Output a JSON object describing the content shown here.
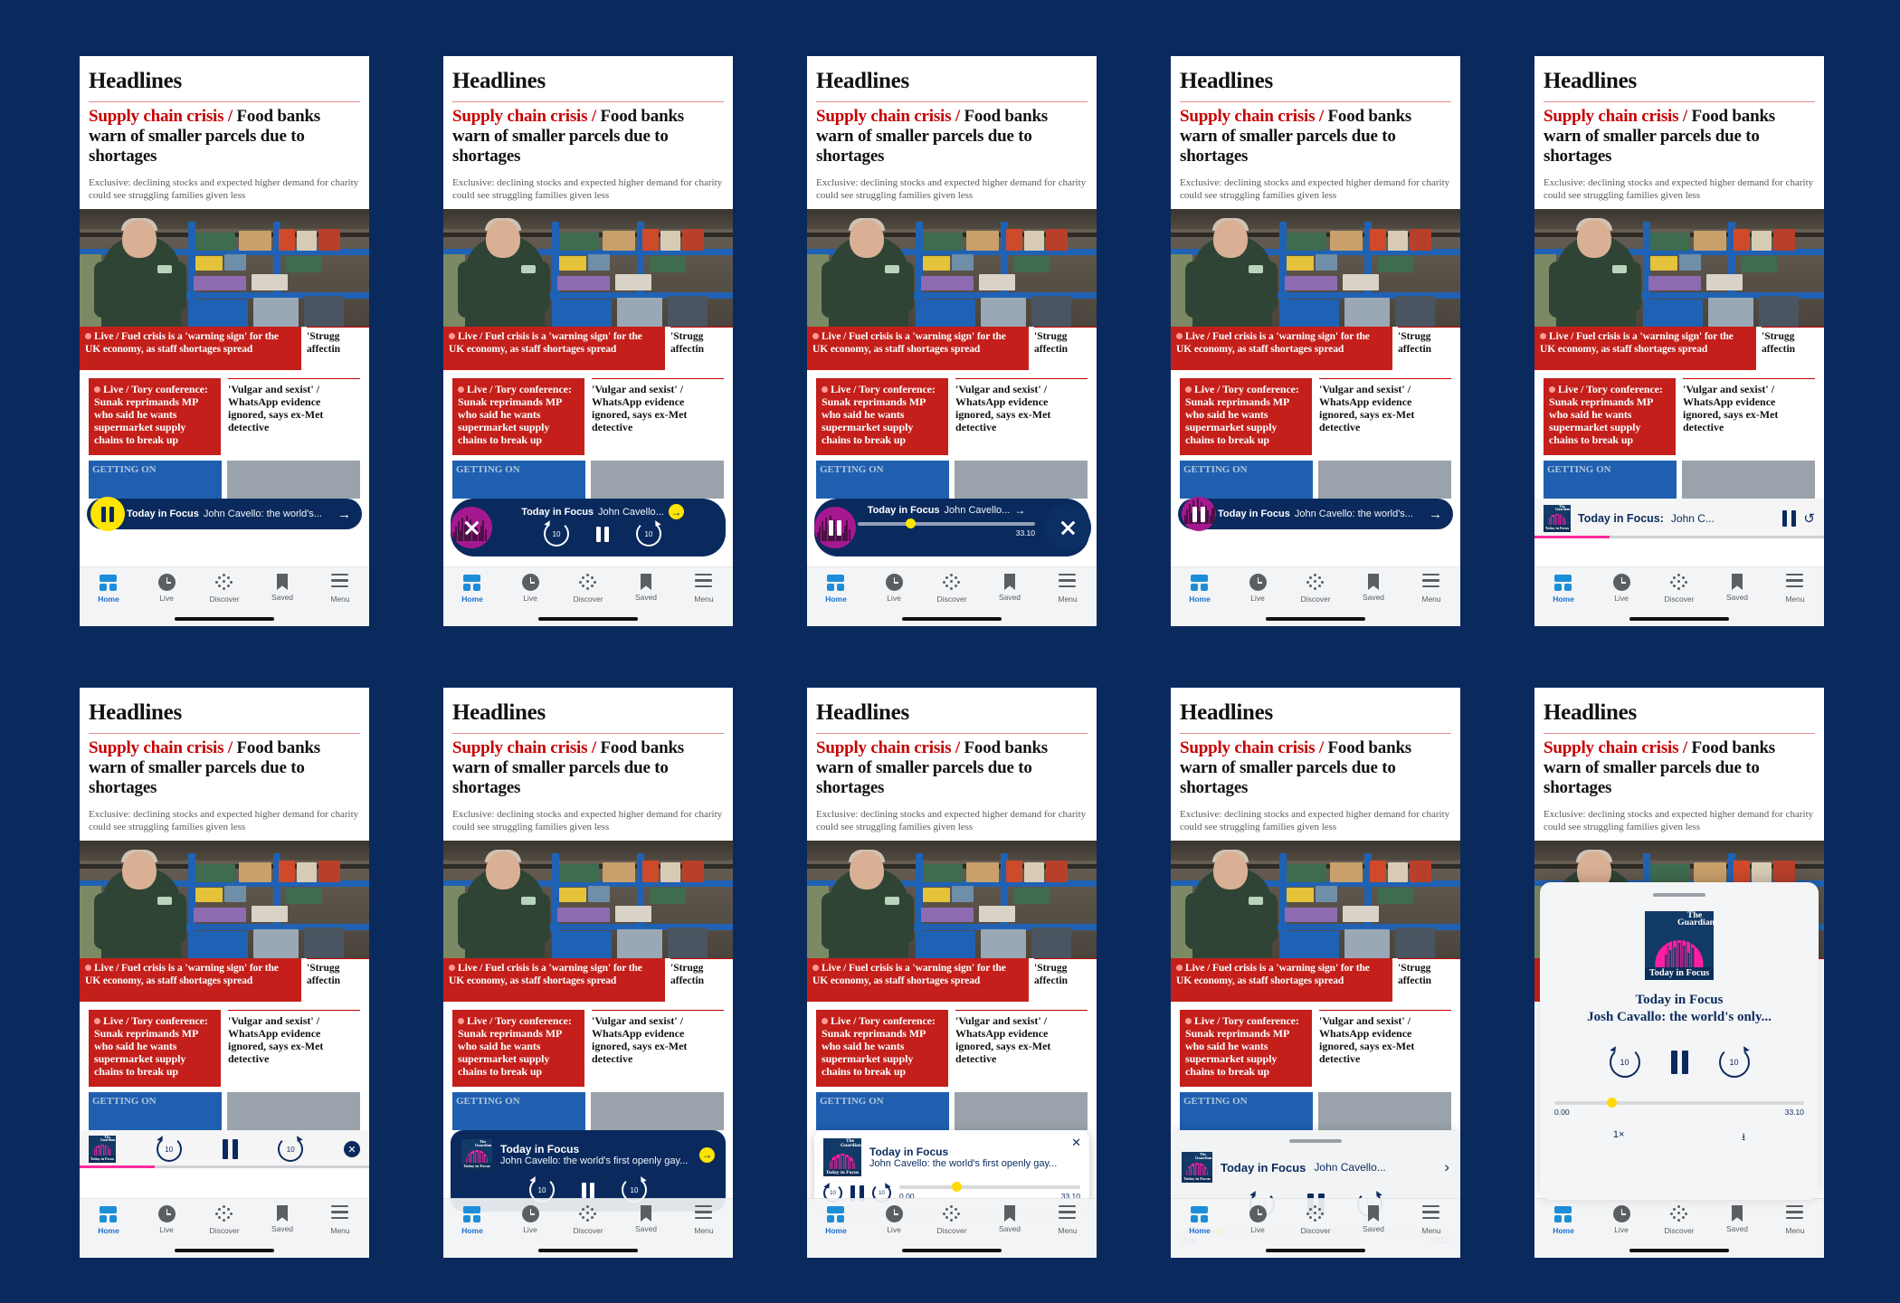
{
  "meta": {
    "background": "#0a2a5e",
    "brand_red": "#c41f1a",
    "brand_blue": "#0a2a5e",
    "accent_yellow": "#ffe500",
    "accent_magenta": "#a51890",
    "pink_progress": "#ff2a9d"
  },
  "article": {
    "section_title": "Headlines",
    "kicker": "Supply chain crisis /",
    "headline": " Food banks warn of smaller parcels due to shortages",
    "standfirst": "Exclusive: declining stocks and expected higher demand for charity could see struggling families given less",
    "live_label": "Live /",
    "live_wide_text": "Fuel crisis is a 'warning sign' for the UK economy, as staff shortages spread",
    "side_clip_line1": "'Strugg",
    "side_clip_line2": "affectin",
    "card_left_label": "Live /",
    "card_left_text": "Tory conference: Sunak reprimands MP who said he wants supermarket supply chains to break up",
    "card_right_text": "'Vulgar and sexist' / WhatsApp evidence ignored, says ex-Met detective",
    "ghost_text": "GETTING ON"
  },
  "nav": {
    "items": [
      {
        "label": "Home",
        "icon": "home-icon",
        "active": true
      },
      {
        "label": "Live",
        "icon": "clock-icon",
        "active": false
      },
      {
        "label": "Discover",
        "icon": "discover-dots-icon",
        "active": false
      },
      {
        "label": "Saved",
        "icon": "bookmark-icon",
        "active": false
      },
      {
        "label": "Menu",
        "icon": "hamburger-icon",
        "active": false
      }
    ]
  },
  "podcast": {
    "show": "Today in Focus",
    "show_colon": "Today in Focus:",
    "episode_short": "John Cavello...",
    "episode_medium": "John Cavello: the world's...",
    "episode_long": "John Cavello: the world's first openly gay...",
    "episode_truncated": "John C...",
    "full_title": "Today in Focus",
    "full_episode": "Josh Cavallo: the world's only...",
    "time_start": "0.00",
    "time_end": "33.10",
    "skip_seconds": "10",
    "speed": "1×",
    "artwork_caption": "Today in Focus",
    "artwork_brand": "The Guardian"
  },
  "phones": [
    {
      "id": 1,
      "variant": "mini-pill-yellow",
      "player_label": "mini player with yellow pause knob"
    },
    {
      "id": 2,
      "variant": "pill-magenta-close",
      "player_label": "expanded pill with magenta close knob"
    },
    {
      "id": 3,
      "variant": "pill-scrub-close",
      "player_label": "pill with scrubber and round close"
    },
    {
      "id": 4,
      "variant": "mini-pill-magenta",
      "player_label": "mini player with magenta pause knob"
    },
    {
      "id": 5,
      "variant": "light-bar",
      "player_label": "light mini bar with artwork"
    },
    {
      "id": 6,
      "variant": "light-bar-controls",
      "player_label": "light bar with transport controls"
    },
    {
      "id": 7,
      "variant": "navy-card",
      "player_label": "navy expanded card player"
    },
    {
      "id": 8,
      "variant": "white-card",
      "player_label": "white card player with scrubber"
    },
    {
      "id": 9,
      "variant": "grey-sheet",
      "player_label": "grey sheet player"
    },
    {
      "id": 10,
      "variant": "full-screen",
      "player_label": "full-screen player"
    }
  ]
}
